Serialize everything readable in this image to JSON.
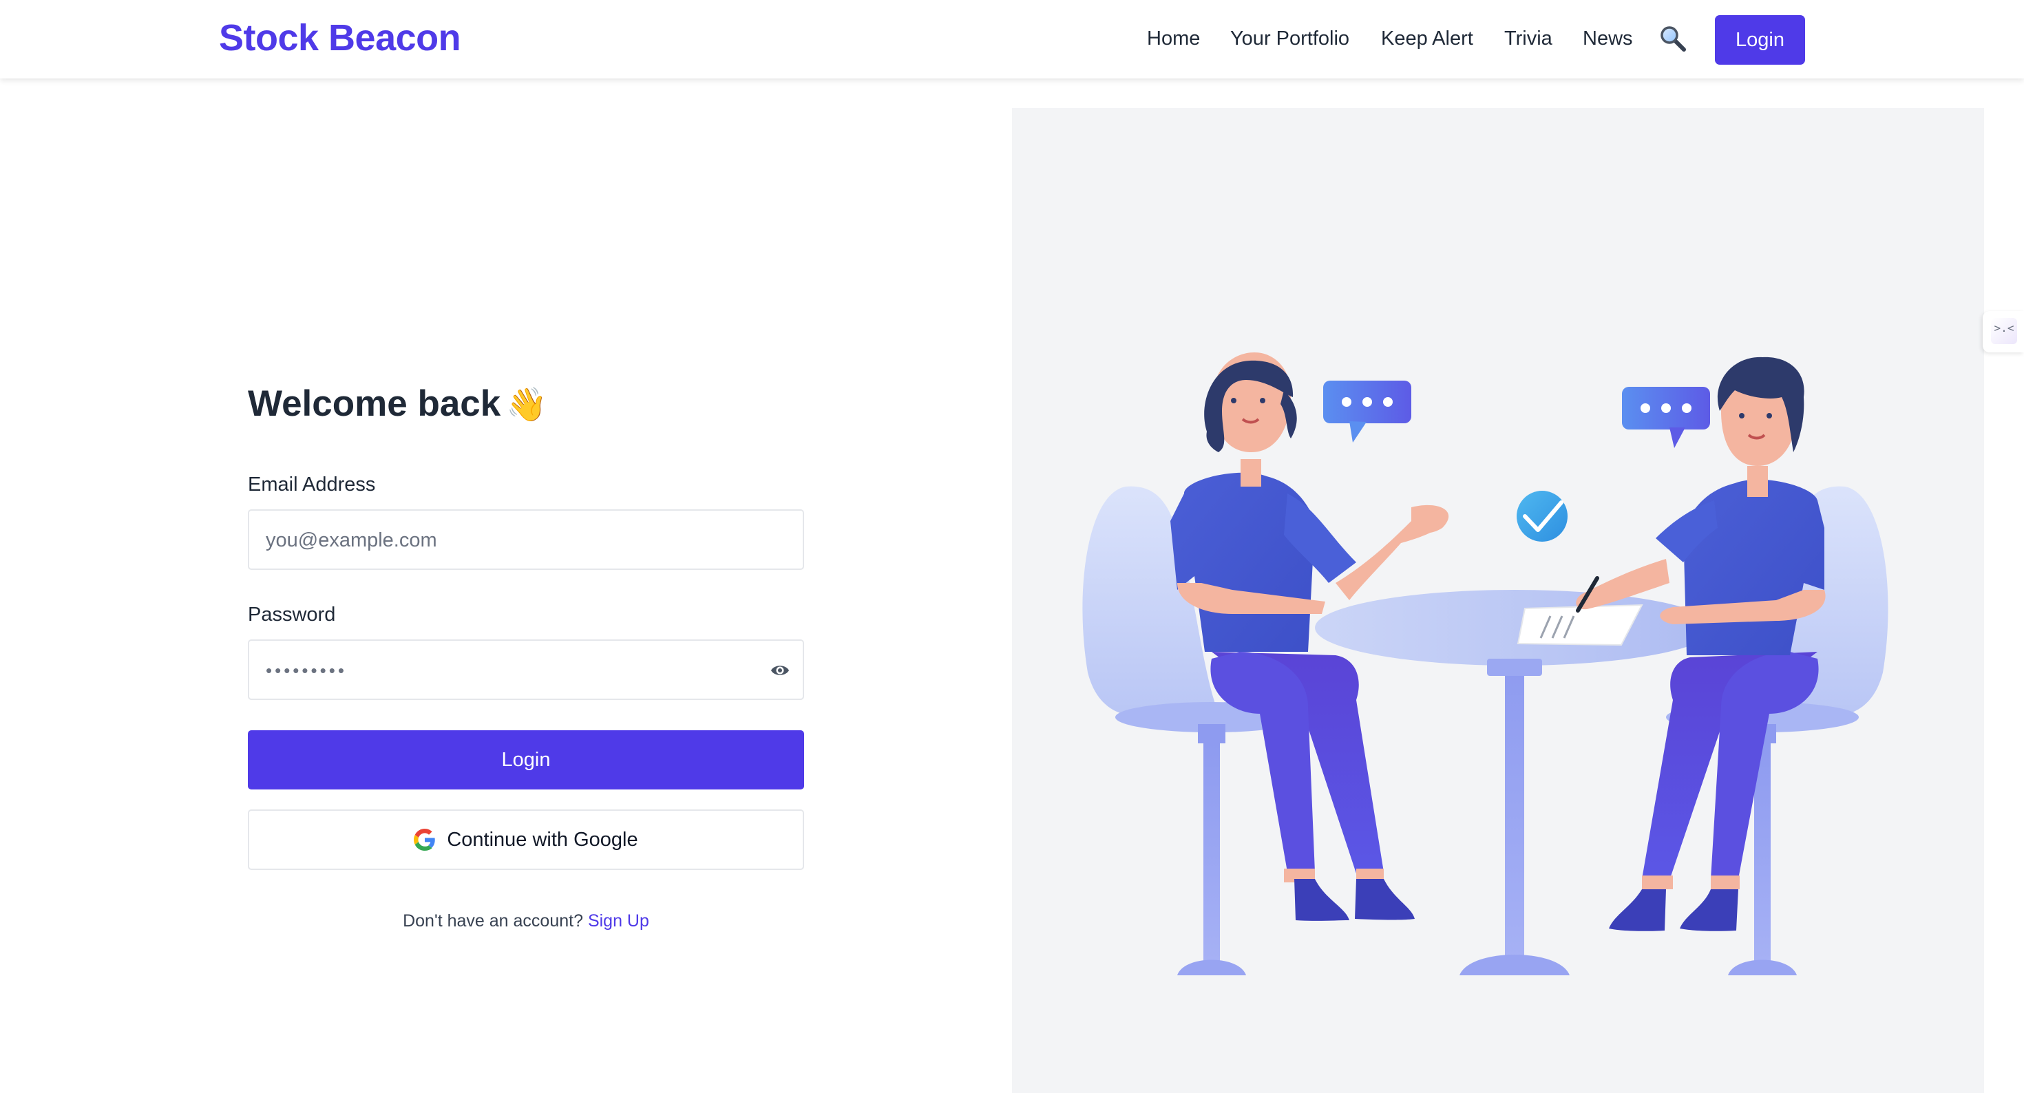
{
  "brand": "Stock Beacon",
  "nav": {
    "items": [
      "Home",
      "Your Portfolio",
      "Keep Alert",
      "Trivia",
      "News"
    ],
    "search_icon": "search-icon",
    "login_label": "Login"
  },
  "form": {
    "title": "Welcome back",
    "title_emoji": "👋",
    "email_label": "Email Address",
    "email_placeholder": "you@example.com",
    "email_value": "",
    "password_label": "Password",
    "password_value": "•••••••••",
    "show_password_icon": "eye-icon",
    "login_button": "Login",
    "google_button": "Continue with Google",
    "google_icon": "google-icon",
    "signup_prompt": "Don't have an account?",
    "signup_link": "Sign Up"
  },
  "side_tab": {
    "icon": "collapse-icon",
    "label": ">.<"
  },
  "colors": {
    "brand": "#4f3ae8",
    "panel_bg": "#f3f4f6",
    "text": "#1f2937"
  }
}
